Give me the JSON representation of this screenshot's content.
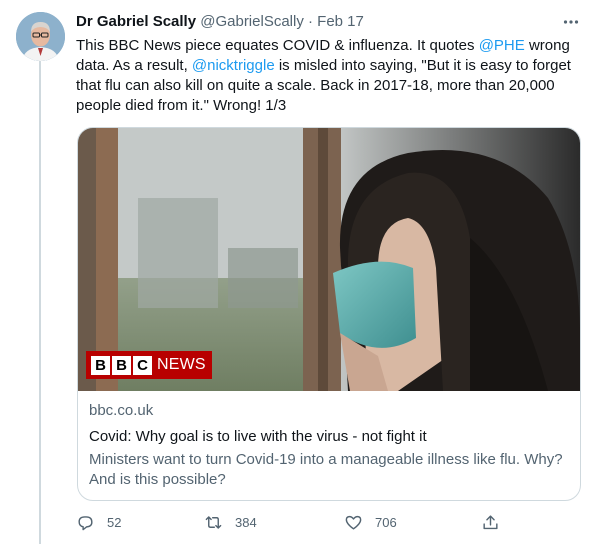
{
  "tweet": {
    "author_name": "Dr Gabriel Scally",
    "author_handle": "@GabrielScally",
    "separator": "·",
    "date": "Feb 17",
    "text_parts": [
      "This BBC News piece equates COVID & influenza. It quotes ",
      "@PHE",
      " wrong data. As a result, ",
      "@nicktriggle",
      " is misled into saying, \"But it is easy to forget that flu can also kill on quite a scale. Back in 2017-18, more than 20,000 people died from it.\" Wrong! 1/3"
    ]
  },
  "card": {
    "image_icon": "woman-with-mask-photo",
    "logo_letters": [
      "B",
      "B",
      "C"
    ],
    "logo_word": "NEWS",
    "domain": "bbc.co.uk",
    "title": "Covid: Why goal is to live with the virus - not fight it",
    "description": "Ministers want to turn Covid-19 into a manageable illness like flu. Why? And is this possible?"
  },
  "actions": {
    "reply_count": "52",
    "retweet_count": "384",
    "like_count": "706"
  },
  "colors": {
    "link": "#1d9bf0",
    "secondary_text": "#536471",
    "bbc_red": "#b80000"
  }
}
